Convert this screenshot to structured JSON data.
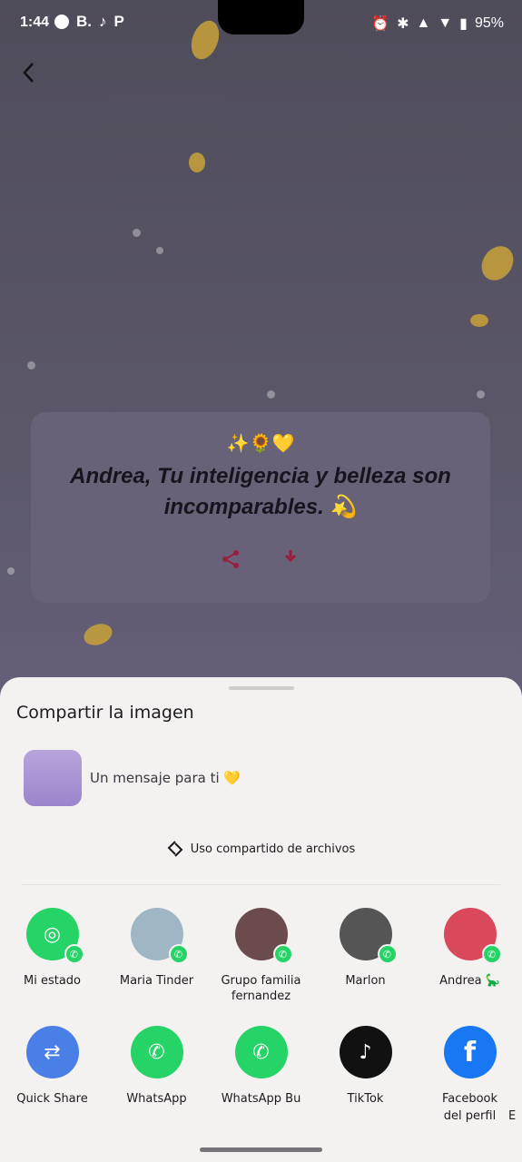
{
  "status_bar": {
    "time": "1:44",
    "app_icons": [
      "facebook-icon",
      "B.",
      "tiktok-icon",
      "P"
    ],
    "battery": "95%"
  },
  "card": {
    "emojis": "✨🌻💛",
    "message": "Andrea, Tu inteligencia y belleza son incomparables. 💫"
  },
  "share_sheet": {
    "title": "Compartir la imagen",
    "preview_text": "Un mensaje para ti 💛",
    "nearby_label": "Uso compartido de archivos",
    "direct_targets": [
      {
        "label": "Mi estado",
        "color": "#25d366"
      },
      {
        "label": "Maria Tinder",
        "color": "#9fb6c4"
      },
      {
        "label": "Grupo familia fernandez",
        "color": "#6b4b4e"
      },
      {
        "label": "Marlon",
        "color": "#555555"
      },
      {
        "label": "Andrea 🦕",
        "color": "#d9485b"
      }
    ],
    "apps": [
      {
        "label": "Quick Share",
        "color": "#4b7fe8"
      },
      {
        "label": "WhatsApp",
        "color": "#25d366"
      },
      {
        "label": "WhatsApp Bu",
        "color": "#25d366"
      },
      {
        "label": "TikTok",
        "color": "#111111"
      },
      {
        "label": "Facebook",
        "sub": "del perfil",
        "color": "#1877f2"
      }
    ],
    "edge_label": "E"
  }
}
